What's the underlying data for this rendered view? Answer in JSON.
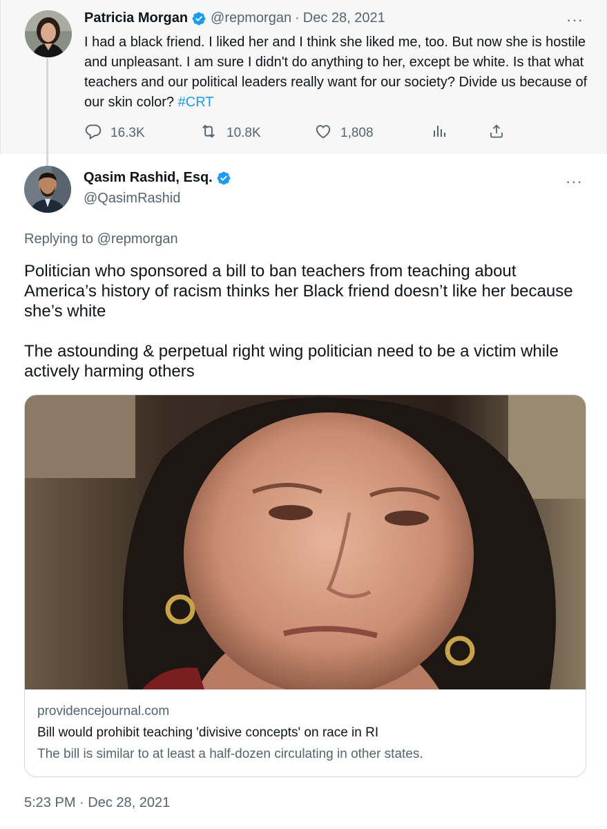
{
  "parent_tweet": {
    "name": "Patricia Morgan",
    "handle": "@repmorgan",
    "separator": "·",
    "date": "Dec 28, 2021",
    "text": "I had a black friend. I liked her and I think she liked me, too. But now she is hostile and unpleasant. I am sure I didn't do anything to her, except be white. Is that what teachers and our political leaders really want for our society?  Divide us because of our skin color? ",
    "hashtag": "#CRT",
    "replies": "16.3K",
    "retweets": "10.8K",
    "likes": "1,808"
  },
  "main_tweet": {
    "name": "Qasim Rashid, Esq.",
    "handle": "@QasimRashid",
    "replying_label": "Replying to ",
    "replying_handle": "@repmorgan",
    "paragraph_1": "Politician who sponsored a bill to ban teachers from teaching about America’s history of racism thinks her Black friend doesn’t like her because she’s white",
    "paragraph_2": "The astounding & perpetual right wing politician need to be a victim while actively harming others",
    "card": {
      "domain": "providencejournal.com",
      "title": "Bill would prohibit teaching 'divisive concepts' on race in RI",
      "description": "The bill is similar to at least a half-dozen circulating in other states."
    },
    "timestamp": "5:23 PM · Dec 28, 2021"
  },
  "more_label": "···",
  "colors": {
    "accent": "#1d9bf0",
    "secondary_text": "#536471",
    "parent_background": "#f7f7f7"
  }
}
